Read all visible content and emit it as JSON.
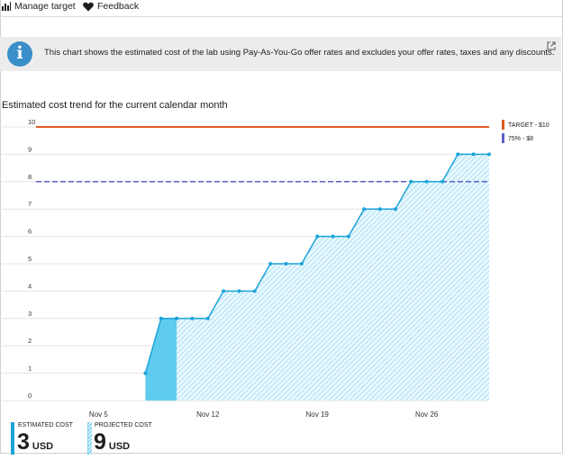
{
  "toolbar": {
    "manage_target_label": "Manage target",
    "feedback_label": "Feedback"
  },
  "banner": {
    "icon_glyph": "i",
    "text": "This chart shows the estimated cost of the lab using Pay-As-You-Go offer rates and excludes your offer rates, taxes and any discounts."
  },
  "chart_title": "Estimated cost trend for the current calendar month",
  "chart_data": {
    "type": "area",
    "title": "Estimated cost trend for the current calendar month",
    "xlabel": "",
    "ylabel": "",
    "x_range": [
      "2023-11-01",
      "2023-11-30"
    ],
    "ylim": [
      0,
      10
    ],
    "y_ticks": [
      0,
      1,
      2,
      3,
      4,
      5,
      6,
      7,
      8,
      9,
      10
    ],
    "x_ticks": [
      {
        "label": "Nov 5",
        "day": 5
      },
      {
        "label": "Nov 12",
        "day": 12
      },
      {
        "label": "Nov 19",
        "day": 19
      },
      {
        "label": "Nov 26",
        "day": 26
      }
    ],
    "grid": true,
    "legend_position": "right",
    "series": [
      {
        "name": "Estimated cost",
        "style": "solid-fill",
        "color": "#1aa3d9",
        "fill": "#5fcbef",
        "x": [
          8,
          9,
          10
        ],
        "y": [
          1,
          3,
          3
        ]
      },
      {
        "name": "Projected cost",
        "style": "hatched-fill",
        "color": "#1aa3d9",
        "fill": "#7fd2ef",
        "x": [
          10,
          11,
          12,
          13,
          14,
          15,
          16,
          17,
          18,
          19,
          20,
          21,
          22,
          23,
          24,
          25,
          26,
          27,
          28,
          29,
          30
        ],
        "y": [
          3,
          3,
          3,
          4,
          4,
          4,
          5,
          5,
          5,
          6,
          6,
          6,
          7,
          7,
          7,
          8,
          8,
          8,
          9,
          9,
          9
        ]
      }
    ],
    "reference_lines": [
      {
        "name": "TARGET - $10",
        "value": 10,
        "color": "#e05a1f",
        "style": "solid"
      },
      {
        "name": "75% - $8",
        "value": 8,
        "color": "#5b5fc7",
        "style": "dashed"
      }
    ]
  },
  "summary": {
    "estimated": {
      "label": "ESTIMATED COST",
      "value": "3",
      "unit": "USD",
      "color": "#1aa3d9"
    },
    "projected": {
      "label": "PROJECTED COST",
      "value": "9",
      "unit": "USD",
      "color": "#7fd2ef"
    }
  }
}
